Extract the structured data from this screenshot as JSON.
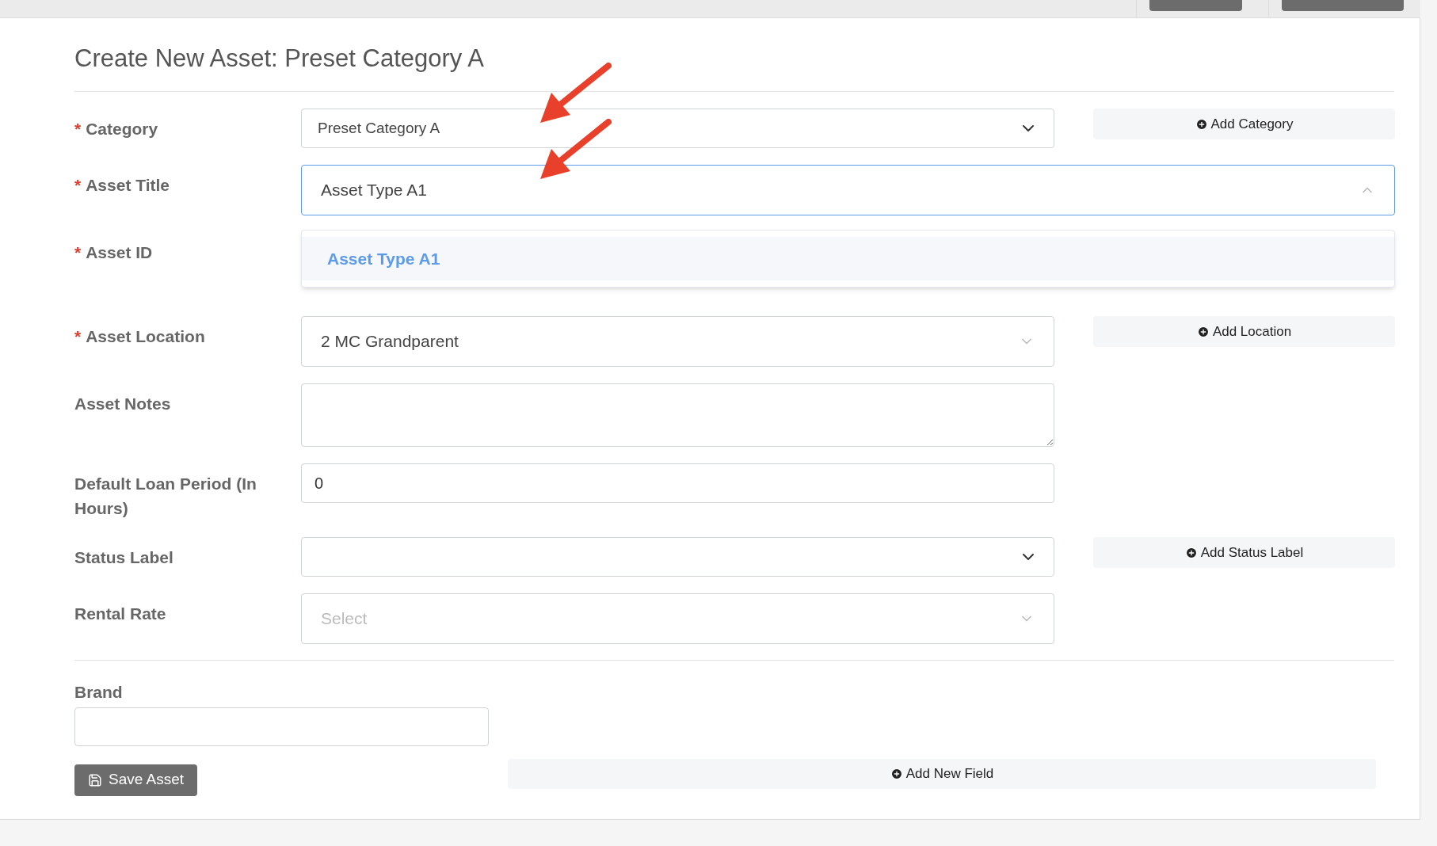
{
  "title": "Create New Asset: Preset Category A",
  "fields": [
    {
      "kind": "select",
      "label": "Category",
      "required": true,
      "value": "Preset Category A",
      "side_button": "Add Category"
    },
    {
      "kind": "dropdown",
      "label": "Asset Title",
      "required": true,
      "value": "Asset Type A1",
      "open": true,
      "options": [
        {
          "label": "Asset Type A1",
          "selected": true
        }
      ]
    },
    {
      "kind": "covered",
      "label": "Asset ID",
      "required": true
    },
    {
      "kind": "dropdown",
      "label": "Asset Location",
      "required": true,
      "value": "2 MC Grandparent",
      "open": false,
      "side_button": "Add Location"
    },
    {
      "kind": "textarea",
      "label": "Asset Notes",
      "required": false
    },
    {
      "kind": "input",
      "label": "Default Loan Period (In Hours)",
      "required": false,
      "value": "0"
    },
    {
      "kind": "select",
      "label": "Status Label",
      "required": false,
      "side_button": "Add Status Label"
    },
    {
      "kind": "dropdown",
      "label": "Rental Rate",
      "required": false,
      "placeholder": "Select",
      "open": false
    }
  ],
  "required_mark": "*",
  "brand": {
    "label": "Brand"
  },
  "save_button": "Save Asset",
  "add_field_button": "Add New Field"
}
